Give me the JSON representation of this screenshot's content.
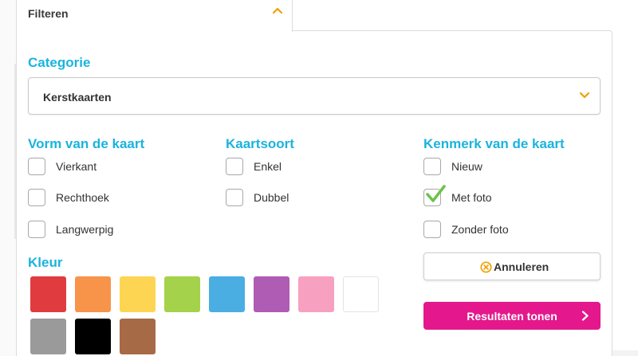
{
  "filter_tab": {
    "title": "Filteren",
    "icon": "chevron-up-icon",
    "expanded": true
  },
  "category": {
    "heading": "Categorie",
    "selected": "Kerstkaarten",
    "icon": "chevron-down-icon"
  },
  "shape": {
    "heading": "Vorm van de kaart",
    "options": [
      {
        "label": "Vierkant",
        "checked": false
      },
      {
        "label": "Rechthoek",
        "checked": false
      },
      {
        "label": "Langwerpig",
        "checked": false
      }
    ]
  },
  "card_type": {
    "heading": "Kaartsoort",
    "options": [
      {
        "label": "Enkel",
        "checked": false
      },
      {
        "label": "Dubbel",
        "checked": false
      }
    ]
  },
  "feature": {
    "heading": "Kenmerk van de kaart",
    "options": [
      {
        "label": "Nieuw",
        "checked": false
      },
      {
        "label": "Met foto",
        "checked": true
      },
      {
        "label": "Zonder foto",
        "checked": false
      }
    ]
  },
  "color": {
    "heading": "Kleur",
    "swatches": [
      {
        "name": "red",
        "hex": "#e03c3f"
      },
      {
        "name": "orange",
        "hex": "#f8944a"
      },
      {
        "name": "yellow",
        "hex": "#fdd552"
      },
      {
        "name": "green",
        "hex": "#a4d24a"
      },
      {
        "name": "blue",
        "hex": "#4aaee3"
      },
      {
        "name": "purple",
        "hex": "#ae5cb4"
      },
      {
        "name": "pink",
        "hex": "#f7a0bf"
      },
      {
        "name": "white",
        "hex": "#ffffff"
      },
      {
        "name": "gray",
        "hex": "#9a9a9a"
      },
      {
        "name": "black",
        "hex": "#000000"
      },
      {
        "name": "brown",
        "hex": "#a66a46"
      }
    ]
  },
  "actions": {
    "cancel_label": "Annuleren",
    "cancel_icon": "close-circle-icon",
    "submit_label": "Resultaten tonen",
    "submit_icon": "chevron-right-icon"
  },
  "theme": {
    "heading_color": "#1ab3de",
    "accent_orange": "#f0a000",
    "check_green": "#6cc24a",
    "primary_pink": "#e4188c"
  }
}
